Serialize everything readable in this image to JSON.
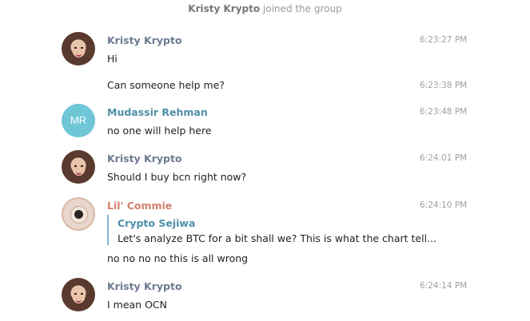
{
  "service_message": {
    "name": "Kristy Krypto",
    "action": " joined the group"
  },
  "messages": [
    {
      "sender": "Kristy Krypto",
      "avatar": "woman-photo",
      "time": "6:23:27 PM",
      "text": "Hi"
    },
    {
      "sender": "",
      "time": "6:23:38 PM",
      "text": "Can someone help me?"
    },
    {
      "sender": "Mudassir Rehman",
      "avatar_initials": "MR",
      "avatar_color": "#6ec6d6",
      "time": "6:23:48 PM",
      "text": "no one will help here"
    },
    {
      "sender": "Kristy Krypto",
      "avatar": "woman-photo",
      "time": "6:24:01 PM",
      "text": "Should I buy bcn right now?"
    },
    {
      "sender": "Lil' Commie",
      "avatar": "coffee-cup-photo",
      "time": "6:24:10 PM",
      "reply": {
        "author": "Crypto Sejiwa",
        "text": "Let's analyze BTC for a bit shall we? This is what the chart tell..."
      },
      "text": "no no no no this is all wrong"
    },
    {
      "sender": "Kristy Krypto",
      "avatar": "woman-photo",
      "time": "6:24:14 PM",
      "text": "I mean OCN"
    }
  ],
  "colors": {
    "sender_default": "#6d7a8f",
    "sender_mudassir": "#4e8fa8",
    "sender_lil_commie": "#d0806a",
    "reply_bar": "#7fb5d0",
    "timestamp": "#a0a0a0"
  }
}
